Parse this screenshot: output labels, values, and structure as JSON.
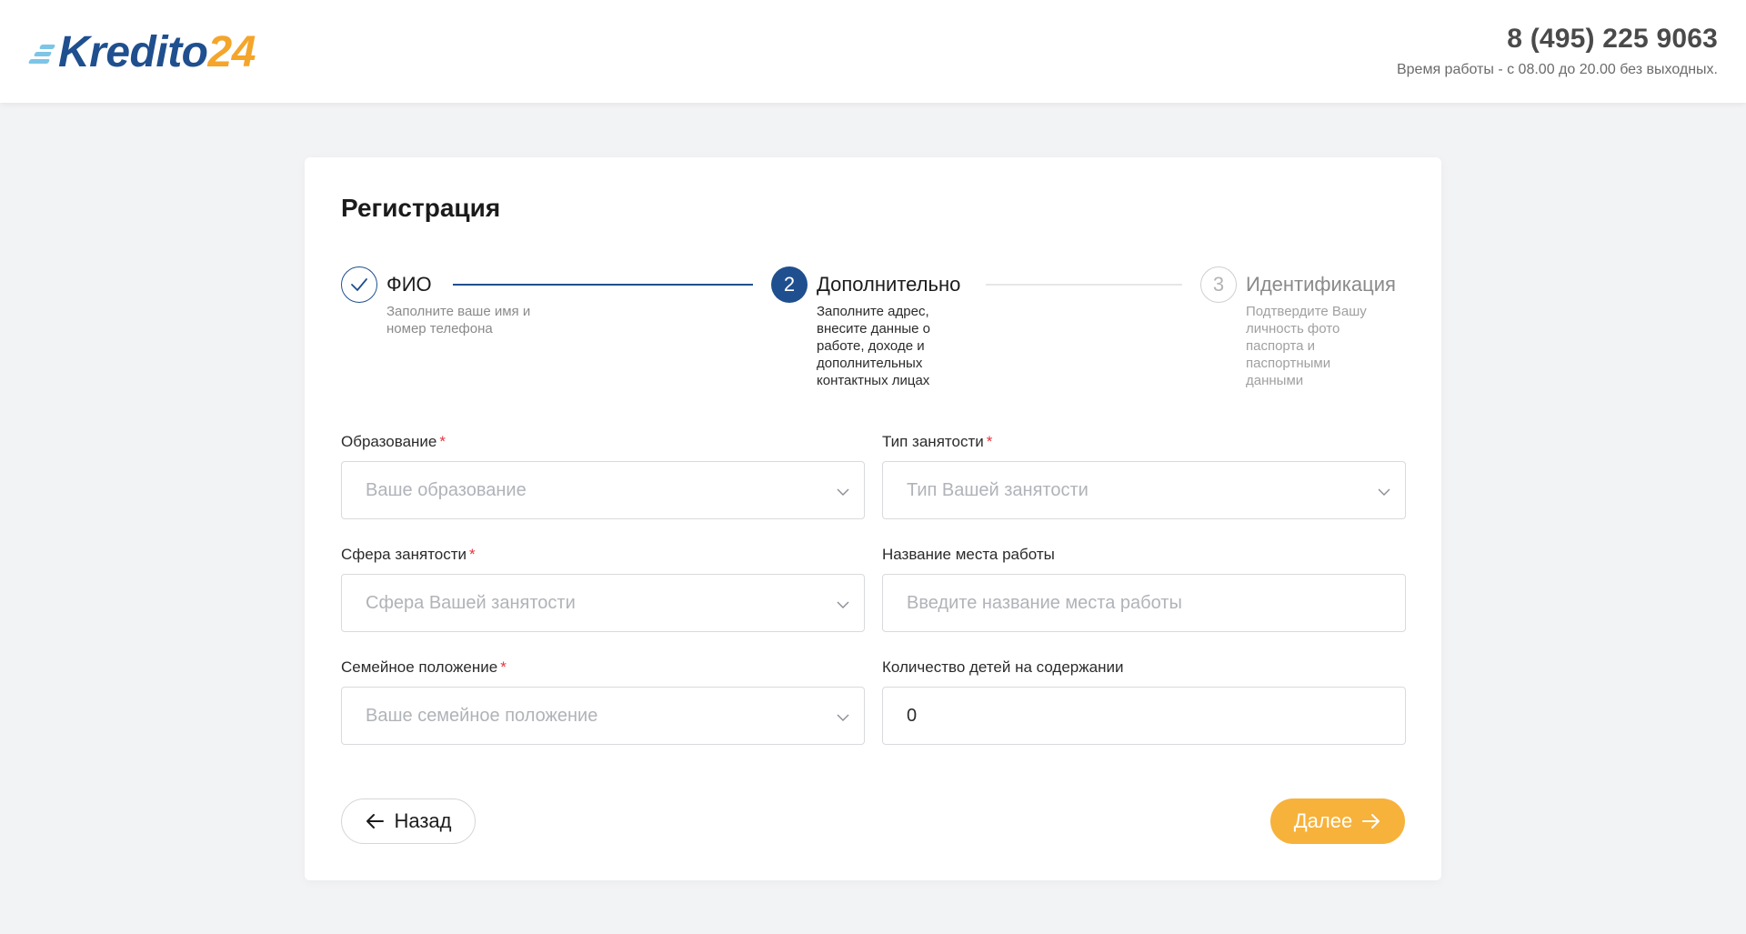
{
  "header": {
    "logo_main": "Kredito",
    "logo_num": "24",
    "phone": "8 (495) 225 9063",
    "hours": "Время работы - с 08.00 до 20.00 без выходных."
  },
  "page": {
    "title": "Регистрация"
  },
  "stepper": {
    "steps": [
      {
        "number": "1",
        "title": "ФИО",
        "description": "Заполните ваше имя и номер телефона",
        "state": "done"
      },
      {
        "number": "2",
        "title": "Дополнительно",
        "description": "Заполните адрес, внесите данные о работе, доходе и дополнительных контактных лицах",
        "state": "active"
      },
      {
        "number": "3",
        "title": "Идентификация",
        "description": "Подтвердите Вашу личность фото паспорта и паспортными данными",
        "state": "todo"
      }
    ]
  },
  "form": {
    "education": {
      "label": "Образование",
      "required": "*",
      "placeholder": "Ваше образование"
    },
    "employment_type": {
      "label": "Тип занятости",
      "required": "*",
      "placeholder": "Тип Вашей занятости"
    },
    "employment_sphere": {
      "label": "Сфера занятости",
      "required": "*",
      "placeholder": "Сфера Вашей занятости"
    },
    "workplace": {
      "label": "Название места работы",
      "placeholder": "Введите название места работы"
    },
    "marital_status": {
      "label": "Семейное положение",
      "required": "*",
      "placeholder": "Ваше семейное положение"
    },
    "children": {
      "label": "Количество детей на содержании",
      "value": "0"
    }
  },
  "buttons": {
    "back": "Назад",
    "next": "Далее"
  },
  "colors": {
    "brand_blue": "#1f4f8e",
    "brand_orange": "#f4a52a",
    "button_orange": "#f7b23b",
    "required_red": "#e3343f"
  }
}
